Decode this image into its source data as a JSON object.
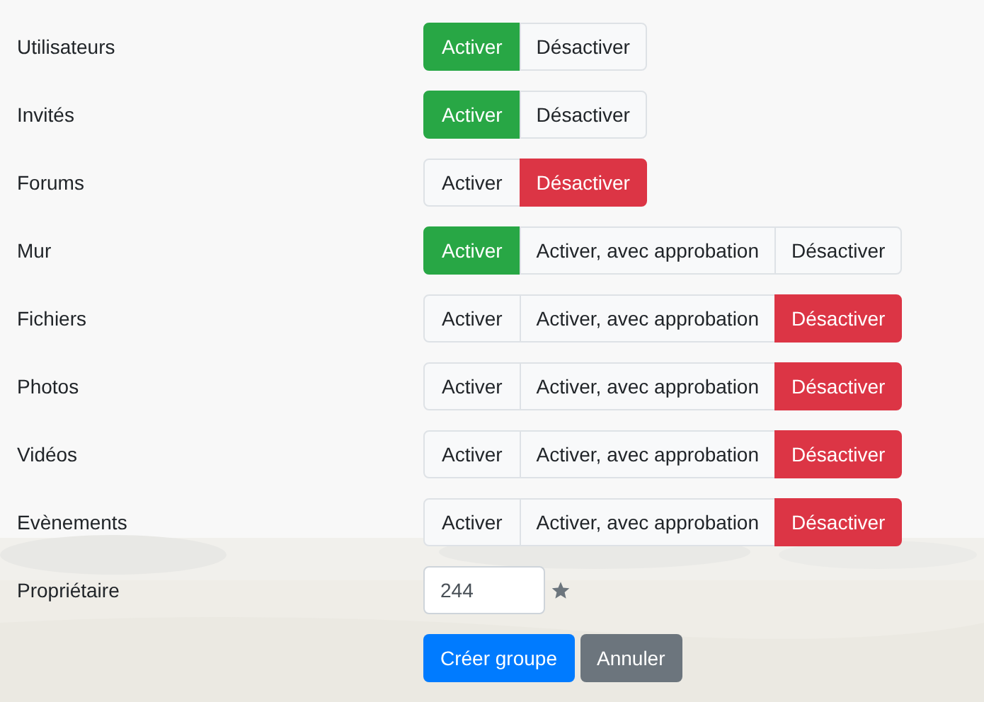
{
  "settings": [
    {
      "label": "Utilisateurs",
      "options": [
        {
          "kind": "enable",
          "label": "Activer",
          "selected": true
        },
        {
          "kind": "disable",
          "label": "Désactiver",
          "selected": false
        }
      ]
    },
    {
      "label": "Invités",
      "options": [
        {
          "kind": "enable",
          "label": "Activer",
          "selected": true
        },
        {
          "kind": "disable",
          "label": "Désactiver",
          "selected": false
        }
      ]
    },
    {
      "label": "Forums",
      "options": [
        {
          "kind": "enable",
          "label": "Activer",
          "selected": false
        },
        {
          "kind": "disable",
          "label": "Désactiver",
          "selected": true
        }
      ]
    },
    {
      "label": "Mur",
      "options": [
        {
          "kind": "enable",
          "label": "Activer",
          "selected": true
        },
        {
          "kind": "approval",
          "label": "Activer, avec approbation",
          "selected": false
        },
        {
          "kind": "disable",
          "label": "Désactiver",
          "selected": false
        }
      ]
    },
    {
      "label": "Fichiers",
      "options": [
        {
          "kind": "enable",
          "label": "Activer",
          "selected": false
        },
        {
          "kind": "approval",
          "label": "Activer, avec approbation",
          "selected": false
        },
        {
          "kind": "disable",
          "label": "Désactiver",
          "selected": true
        }
      ]
    },
    {
      "label": "Photos",
      "options": [
        {
          "kind": "enable",
          "label": "Activer",
          "selected": false
        },
        {
          "kind": "approval",
          "label": "Activer, avec approbation",
          "selected": false
        },
        {
          "kind": "disable",
          "label": "Désactiver",
          "selected": true
        }
      ]
    },
    {
      "label": "Vidéos",
      "options": [
        {
          "kind": "enable",
          "label": "Activer",
          "selected": false
        },
        {
          "kind": "approval",
          "label": "Activer, avec approbation",
          "selected": false
        },
        {
          "kind": "disable",
          "label": "Désactiver",
          "selected": true
        }
      ]
    },
    {
      "label": "Evènements",
      "options": [
        {
          "kind": "enable",
          "label": "Activer",
          "selected": false
        },
        {
          "kind": "approval",
          "label": "Activer, avec approbation",
          "selected": false
        },
        {
          "kind": "disable",
          "label": "Désactiver",
          "selected": true
        }
      ]
    }
  ],
  "owner": {
    "label": "Propriétaire",
    "value": "244"
  },
  "buttons": [
    {
      "kind": "primary",
      "label": "Créer groupe"
    },
    {
      "kind": "secondary",
      "label": "Annuler"
    }
  ]
}
